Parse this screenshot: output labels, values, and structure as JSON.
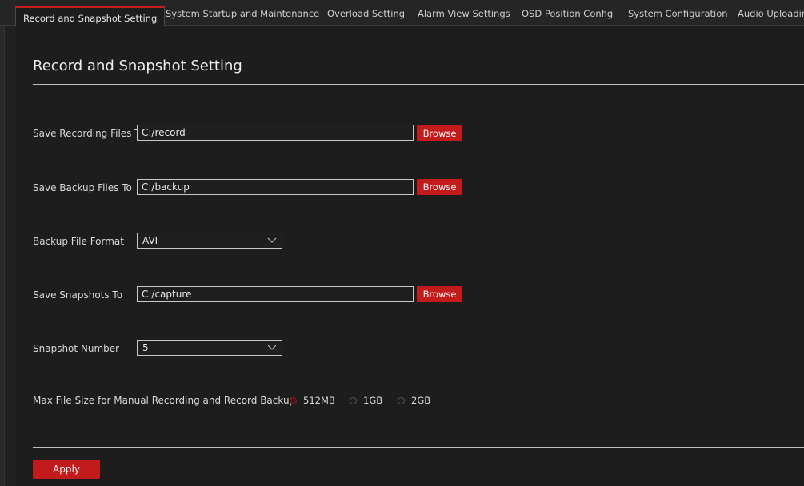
{
  "tabs": [
    {
      "label": "Record and Snapshot Setting",
      "active": true
    },
    {
      "label": "System Startup and Maintenance",
      "active": false
    },
    {
      "label": "Overload Setting",
      "active": false
    },
    {
      "label": "Alarm View Settings",
      "active": false
    },
    {
      "label": "OSD Position Config",
      "active": false
    },
    {
      "label": "System Configuration",
      "active": false
    },
    {
      "label": "Audio Uploadin",
      "active": false
    }
  ],
  "page_title": "Record and Snapshot Setting",
  "recording": {
    "label": "Save Recording Files To",
    "value": "C:/record",
    "browse": "Browse"
  },
  "backup": {
    "label": "Save Backup Files To",
    "value": "C:/backup",
    "browse": "Browse"
  },
  "backup_format": {
    "label": "Backup File Format",
    "value": "AVI"
  },
  "snapshots": {
    "label": "Save Snapshots To",
    "value": "C:/capture",
    "browse": "Browse"
  },
  "snapshot_number": {
    "label": "Snapshot Number",
    "value": "5"
  },
  "max_file_size": {
    "label": "Max File Size for Manual Recording and Record Backup",
    "options": [
      {
        "label": "512MB",
        "checked": true
      },
      {
        "label": "1GB",
        "checked": false
      },
      {
        "label": "2GB",
        "checked": false
      }
    ]
  },
  "apply_label": "Apply",
  "colors": {
    "accent": "#c31b1b",
    "background": "#1d1d1d",
    "text": "#dcdcdc"
  }
}
